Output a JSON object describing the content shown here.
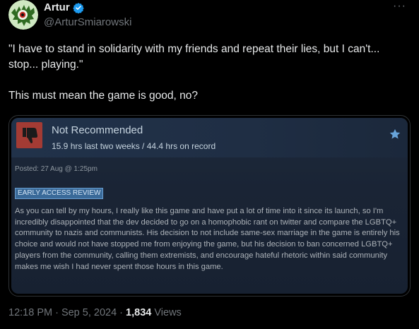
{
  "author": {
    "name": "Artur",
    "handle": "@ArturSmiarowski",
    "avatar_icon": "monster-avatar-icon",
    "verified_icon": "verified-badge-icon"
  },
  "tweet": {
    "text": "\"I have to stand in solidarity with my friends and repeat their lies, but I can't... stop... playing.\"\n\nThis must mean the game is good, no?",
    "more_icon": "more-dots-icon"
  },
  "review": {
    "verdict": "Not Recommended",
    "hours": "15.9 hrs last two weeks / 44.4 hrs on record",
    "posted": "Posted: 27 Aug @ 1:25pm",
    "badge": "EARLY ACCESS REVIEW",
    "body": "As you can tell by my hours, I really like this game and have put a lot of time into it since its launch, so I'm incredibly disappointed that the dev decided to go on a homophobic rant on twitter and compare the LGBTQ+ community to nazis and communists. His decision to not include same-sex marriage in the game is entirely his choice and would not have stopped me from enjoying the game, but his decision to ban concerned LGBTQ+ players from the community, calling them extremists, and encourage hateful rhetoric within said community makes me wish I had never spent those hours in this game.",
    "thumb_icon": "thumbs-down-icon",
    "star_icon": "star-icon",
    "colors": {
      "thumb_bg": "#a33b34",
      "badge_bg": "#3a6a99"
    }
  },
  "meta": {
    "time": "12:18 PM · Sep 5, 2024 · ",
    "views_count": "1,834",
    "views_label": " Views"
  }
}
